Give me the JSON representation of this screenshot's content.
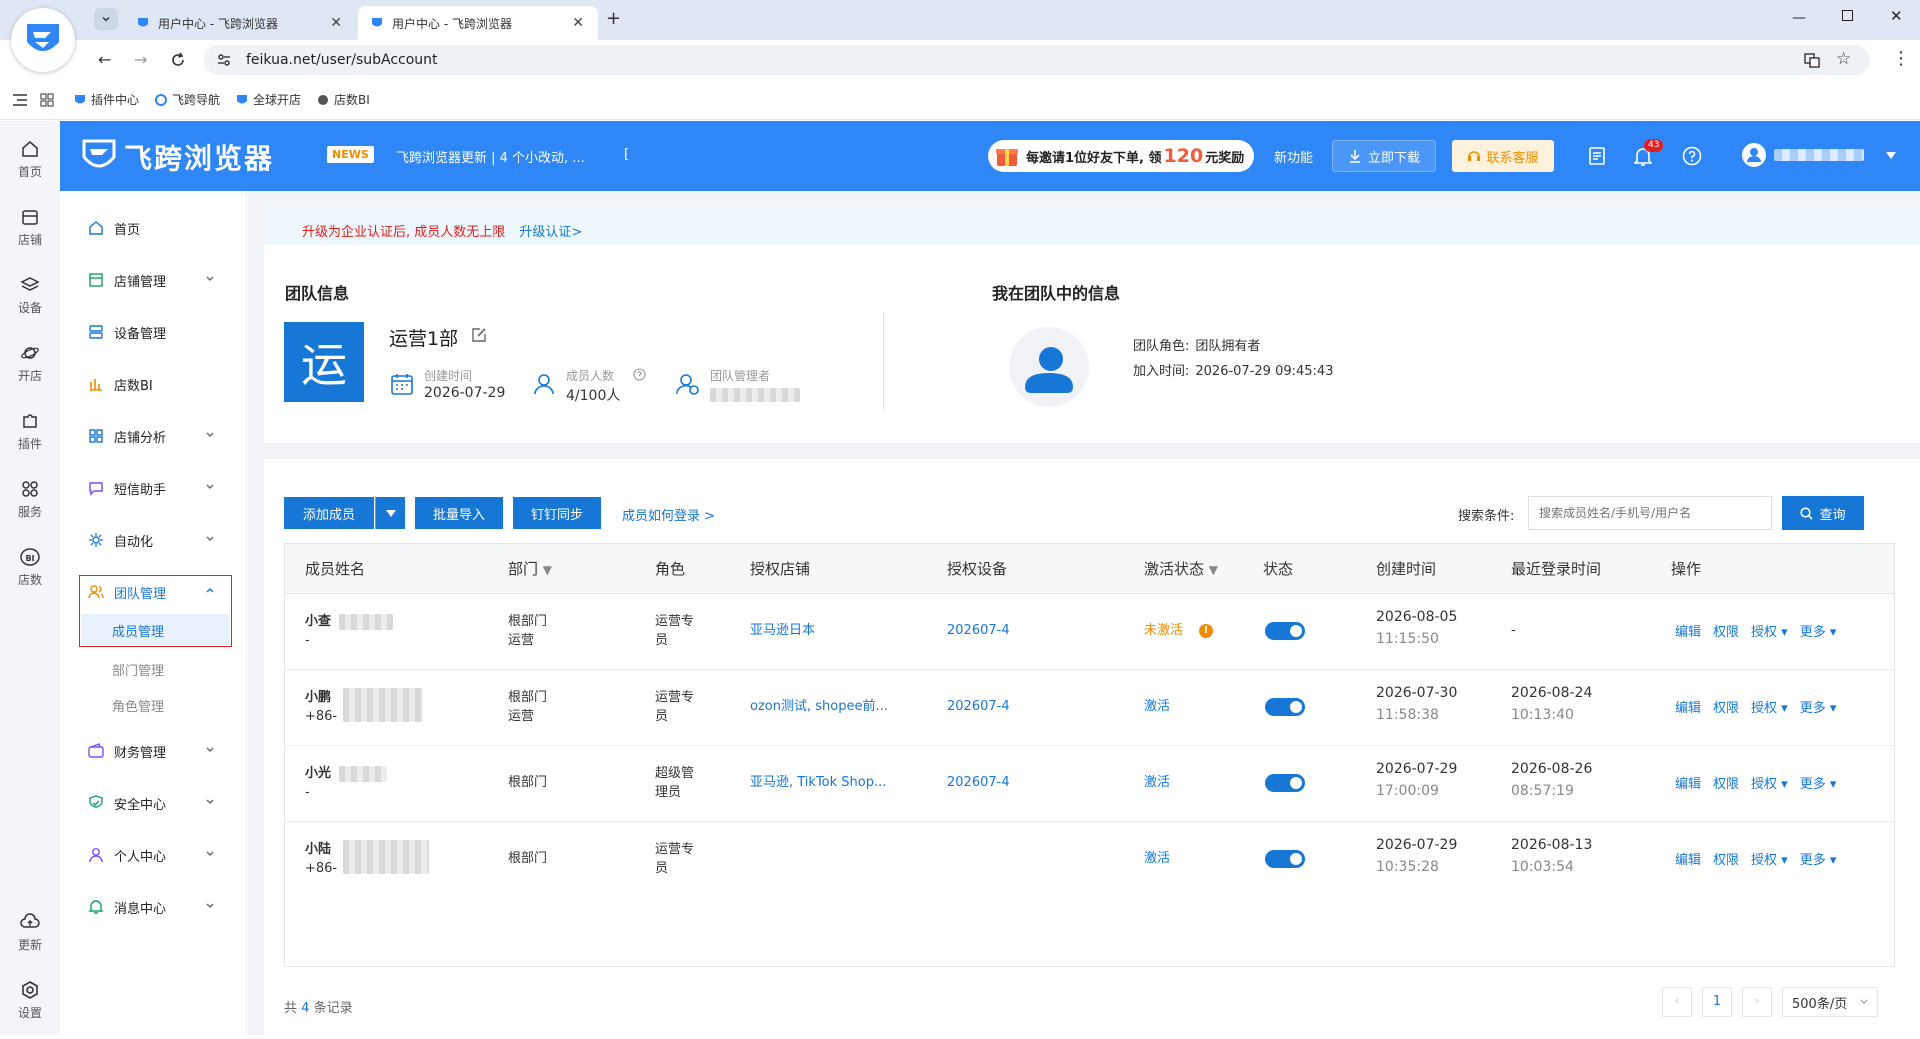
{
  "browser": {
    "tabs": [
      {
        "title": "用户中心 - 飞跨浏览器"
      },
      {
        "title": "用户中心 - 飞跨浏览器"
      }
    ],
    "url": "feikua.net/user/subAccount",
    "bookmarks": [
      "插件中心",
      "飞跨导航",
      "全球开店",
      "店数BI"
    ]
  },
  "header": {
    "logo_text": "飞跨浏览器",
    "news_badge": "NEWS",
    "news_text": "飞跨浏览器更新 | 4 个小改动, ...",
    "news_mark": "[",
    "invite_text_a": "每邀请1位好友下单, 领",
    "invite_amount": "120",
    "invite_text_b": "元奖励",
    "new_features": "新功能",
    "download": "立即下载",
    "support": "联系客服",
    "notification_count": "43"
  },
  "rail": [
    {
      "label": "首页",
      "icon": "home-icon"
    },
    {
      "label": "店铺",
      "icon": "store-icon"
    },
    {
      "label": "设备",
      "icon": "layers-icon"
    },
    {
      "label": "开店",
      "icon": "planet-icon"
    },
    {
      "label": "插件",
      "icon": "puzzle-icon"
    },
    {
      "label": "服务",
      "icon": "grid-icon"
    },
    {
      "label": "店数",
      "icon": "bi-icon"
    },
    {
      "label": "更新",
      "icon": "cloud-icon"
    },
    {
      "label": "设置",
      "icon": "gear-icon"
    }
  ],
  "sidenav": {
    "items": [
      {
        "label": "首页"
      },
      {
        "label": "店铺管理"
      },
      {
        "label": "设备管理"
      },
      {
        "label": "店数BI"
      },
      {
        "label": "店铺分析"
      },
      {
        "label": "短信助手"
      },
      {
        "label": "自动化"
      },
      {
        "label": "团队管理"
      },
      {
        "label": "财务管理"
      },
      {
        "label": "安全中心"
      },
      {
        "label": "个人中心"
      },
      {
        "label": "消息中心"
      }
    ],
    "sub_items": [
      "成员管理",
      "部门管理",
      "角色管理"
    ]
  },
  "banner": {
    "text": "升级为企业认证后, 成员人数无上限",
    "link": "升级认证>"
  },
  "team": {
    "section_title": "团队信息",
    "avatar_char": "运",
    "name": "运营1部",
    "created_label": "创建时间",
    "created_value": "2026-07-29",
    "members_label": "成员人数",
    "members_value": "4/100人",
    "manager_label": "团队管理者"
  },
  "my_info": {
    "section_title": "我在团队中的信息",
    "role_label": "团队角色:",
    "role_value": "团队拥有者",
    "join_label": "加入时间:",
    "join_value": "2026-07-29 09:45:43"
  },
  "toolbar": {
    "add_member": "添加成员",
    "batch_import": "批量导入",
    "dingtalk_sync": "钉钉同步",
    "how_to_login": "成员如何登录 >",
    "search_label": "搜索条件:",
    "search_placeholder": "搜索成员姓名/手机号/用户名",
    "query": "查询"
  },
  "table": {
    "columns": [
      "成员姓名",
      "部门",
      "角色",
      "授权店铺",
      "授权设备",
      "激活状态",
      "状态",
      "创建时间",
      "最近登录时间",
      "操作"
    ],
    "ops": [
      "编辑",
      "权限",
      "授权 ▾",
      "更多 ▾"
    ],
    "rows": [
      {
        "name": "小查",
        "sub": "-",
        "dept1": "根部门",
        "dept2": "运营",
        "role1": "运营专",
        "role2": "员",
        "stores": "亚马逊日本",
        "device": "202607-4",
        "activation": "未激活",
        "created_date": "2026-08-05",
        "created_time": "11:15:50",
        "login_date": "-",
        "login_time": ""
      },
      {
        "name": "小鹏",
        "sub": "+86-",
        "dept1": "根部门",
        "dept2": "运营",
        "role1": "运营专",
        "role2": "员",
        "stores": "ozon测试, shopee前...",
        "device": "202607-4",
        "activation": "激活",
        "created_date": "2026-07-30",
        "created_time": "11:58:38",
        "login_date": "2026-08-24",
        "login_time": "10:13:40"
      },
      {
        "name": "小光",
        "sub": "-",
        "dept1": "根部门",
        "dept2": "",
        "role1": "超级管",
        "role2": "理员",
        "stores": "亚马逊, TikTok Shop...",
        "device": "202607-4",
        "activation": "激活",
        "created_date": "2026-07-29",
        "created_time": "17:00:09",
        "login_date": "2026-08-26",
        "login_time": "08:57:19"
      },
      {
        "name": "小陆",
        "sub": "+86-",
        "dept1": "根部门",
        "dept2": "",
        "role1": "运营专",
        "role2": "员",
        "stores": "",
        "device": "",
        "activation": "激活",
        "created_date": "2026-07-29",
        "created_time": "10:35:28",
        "login_date": "2026-08-13",
        "login_time": "10:03:54"
      }
    ]
  },
  "footer": {
    "total_prefix": "共",
    "total_count": "4",
    "total_suffix": "条记录",
    "current_page": "1",
    "page_size": "500条/页"
  },
  "colors": {
    "primary": "#1677d6",
    "header": "#2f86f6",
    "warning": "#f08c00",
    "danger": "#e02020"
  }
}
